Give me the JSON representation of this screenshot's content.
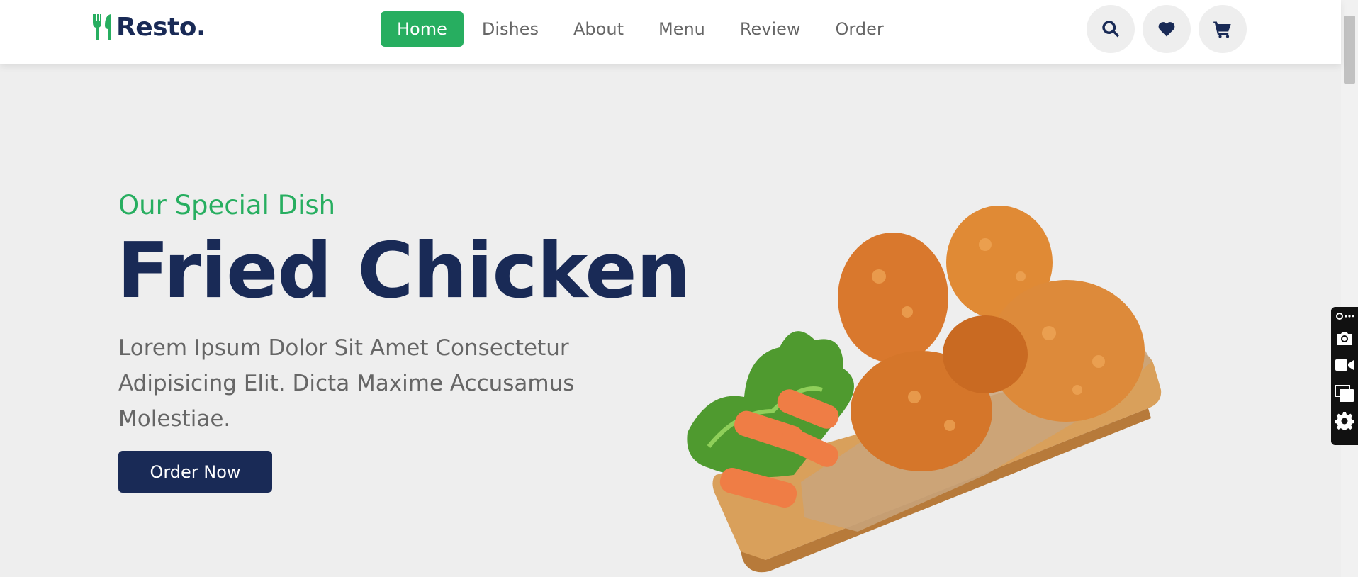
{
  "header": {
    "logo_text": "Resto.",
    "logo_icon": "utensils-icon",
    "nav": [
      {
        "label": "Home",
        "active": true
      },
      {
        "label": "Dishes",
        "active": false
      },
      {
        "label": "About",
        "active": false
      },
      {
        "label": "Menu",
        "active": false
      },
      {
        "label": "Review",
        "active": false
      },
      {
        "label": "Order",
        "active": false
      }
    ],
    "icons": [
      "search-icon",
      "heart-icon",
      "cart-icon"
    ]
  },
  "hero": {
    "subtitle": "Our Special Dish",
    "title": "Fried Chicken",
    "description": "Lorem Ipsum Dolor Sit Amet Consectetur Adipisicing Elit. Dicta Maxime Accusamus Molestiae.",
    "button_label": "Order Now",
    "image_icon": "fried-chicken-image"
  },
  "extension_panel": {
    "icons": [
      "link-more-icon",
      "camera-icon",
      "video-icon",
      "windows-icon",
      "settings-icon"
    ]
  },
  "colors": {
    "accent": "#27ae60",
    "primary": "#192a56",
    "background": "#eeeeee",
    "text_muted": "#666666"
  }
}
